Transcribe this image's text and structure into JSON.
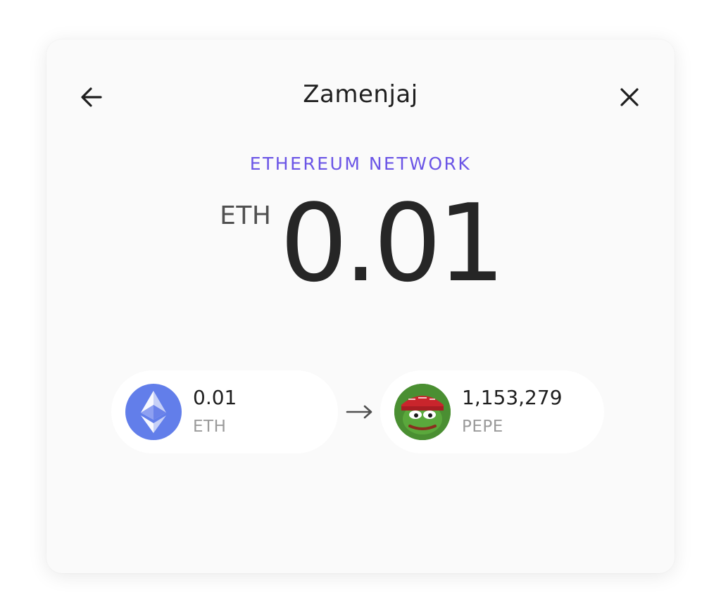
{
  "header": {
    "title": "Zamenjaj"
  },
  "network_label": "ETHEREUM NETWORK",
  "amount": {
    "currency": "ETH",
    "value": "0.01"
  },
  "swap": {
    "from": {
      "amount": "0.01",
      "symbol": "ETH",
      "icon": "ethereum-icon"
    },
    "to": {
      "amount": "1,153,279",
      "symbol": "PEPE",
      "icon": "pepe-icon"
    }
  },
  "colors": {
    "accent": "#6b55e6",
    "eth_blue": "#627eea",
    "pepe_green": "#4a8f32"
  }
}
